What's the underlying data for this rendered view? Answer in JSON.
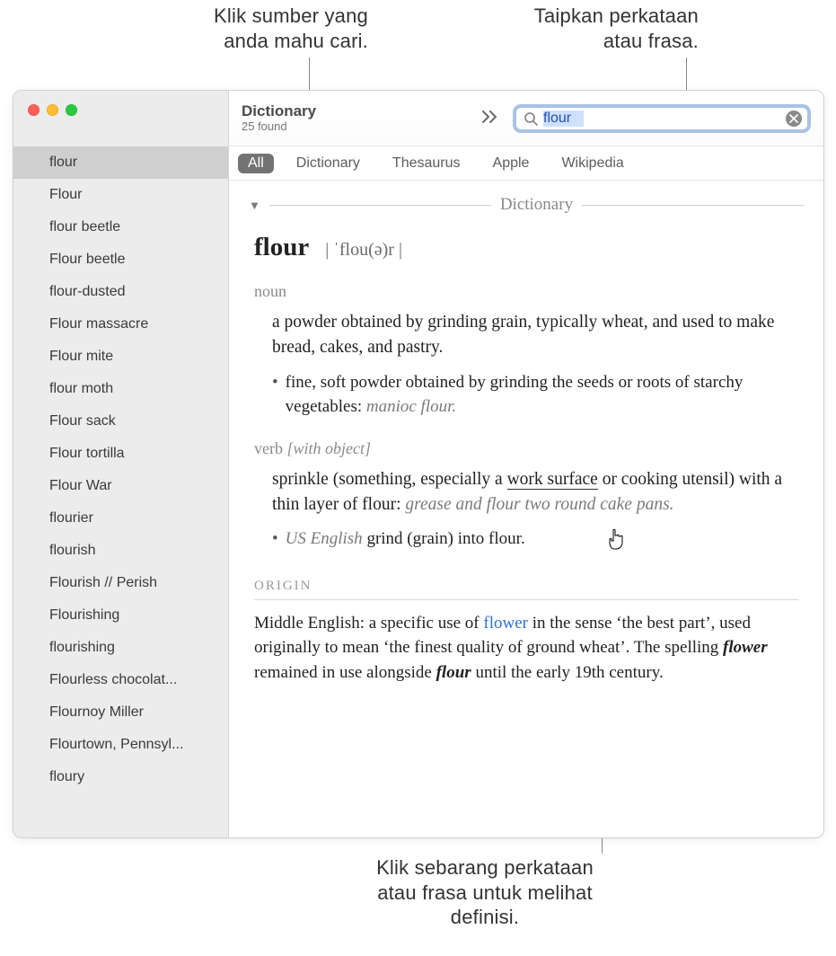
{
  "annotations": {
    "top_left": "Klik sumber yang\nanda mahu cari.",
    "top_right": "Taipkan perkataan\natau frasa.",
    "bottom": "Klik sebarang perkataan\natau frasa untuk melihat\ndefinisi."
  },
  "toolbar": {
    "title": "Dictionary",
    "subtitle": "25 found"
  },
  "search": {
    "value": "flour"
  },
  "sources": {
    "tabs": [
      "All",
      "Dictionary",
      "Thesaurus",
      "Apple",
      "Wikipedia"
    ],
    "active_index": 0
  },
  "sidebar": {
    "items": [
      "flour",
      "Flour",
      "flour beetle",
      "Flour beetle",
      "flour-dusted",
      "Flour massacre",
      "Flour mite",
      "flour moth",
      "Flour sack",
      "Flour tortilla",
      "Flour War",
      "flourier",
      "flourish",
      "Flourish // Perish",
      "Flourishing",
      "flourishing",
      "Flourless chocolat...",
      "Flournoy Miller",
      "Flourtown, Pennsyl...",
      "floury"
    ],
    "selected_index": 0
  },
  "section": {
    "label": "Dictionary"
  },
  "entry": {
    "headword": "flour",
    "pronunciation": "| ˈflou(ə)r |",
    "pos1": "noun",
    "def1": "a powder obtained by grinding grain, typically wheat, and used to make bread, cakes, and pastry",
    "sub1_text": "fine, soft powder obtained by grinding the seeds or roots of starchy vegetables",
    "sub1_example": "manioc flour.",
    "pos2": "verb",
    "pos2_qualifier": "[with object]",
    "def2_a": "sprinkle (something, especially a ",
    "def2_link": "work surface",
    "def2_b": " or cooking utensil) with a thin layer of flour",
    "def2_example": "grease and flour two round cake pans.",
    "sub2_region": "US English",
    "sub2_text": " grind (grain) into flour",
    "origin_label": "ORIGIN",
    "origin_a": "Middle English: a specific use of ",
    "origin_link": "flower",
    "origin_b": " in the sense ‘the best part’, used originally to mean ‘the finest quality of ground wheat’. The spelling ",
    "origin_em1": "flower",
    "origin_c": " remained in use alongside ",
    "origin_em2": "flour",
    "origin_d": " until the early 19th century."
  }
}
